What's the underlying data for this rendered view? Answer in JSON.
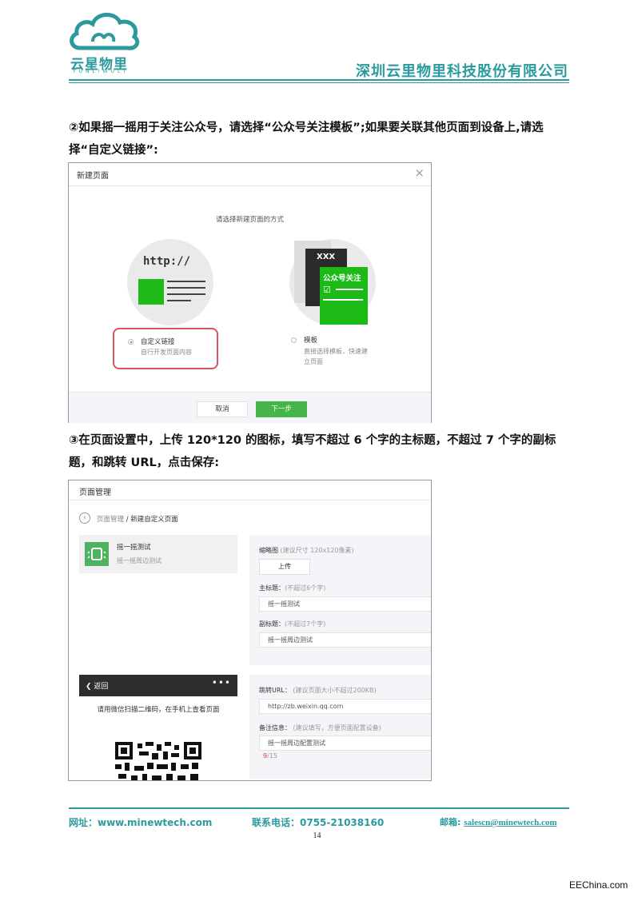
{
  "header": {
    "logo_text": "云星物里",
    "logo_sub": "YUNLIWULI",
    "company": "深圳云里物里科技股份有限公司"
  },
  "colors": {
    "brand": "#2a9a9e",
    "wechat_green": "#44b549",
    "highlight_red": "#d9545f"
  },
  "section2": {
    "text": "②如果摇一摇用于关注公众号，请选择“公众号关注模板”;如果要关联其他页面到设备上,请选择“自定义链接”:",
    "dialog": {
      "title": "新建页面",
      "close": "×",
      "prompt": "请选择新建页面的方式",
      "option_link": {
        "illustration_text": "http://",
        "label": "自定义链接",
        "desc": "自行开发页面内容",
        "selected": true
      },
      "option_template": {
        "illustration_xxx": "XXX",
        "illustration_text": "公众号关注",
        "label": "模板",
        "desc_1": "直接选择模板，快速建",
        "desc_2": "立页面",
        "selected": false
      },
      "cancel": "取消",
      "next": "下一步"
    }
  },
  "section3": {
    "text": "③在页面设置中，上传 120*120 的图标，填写不超过 6 个字的主标题，不超过 7 个字的副标题，和跳转 URL，点击保存:",
    "manager": {
      "title": "页面管理",
      "crumb_root": "页面管理",
      "crumb_sep": " / ",
      "crumb_current": "新建自定义页面",
      "card_title": "摇一摇测试",
      "card_sub": "摇一摇周边测试",
      "thumb_label": "缩略图",
      "thumb_hint": "(建议尺寸 120x120像素)",
      "upload": "上传",
      "main_label": "主标题：",
      "main_hint": "(不超过6个字)",
      "main_value": "摇一摇测试",
      "sub_label": "副标题：",
      "sub_hint": "(不超过7个字)",
      "sub_value": "摇一摇周边测试",
      "url_label": "跳转URL：",
      "url_hint": "(建议页面大小不超过200KB)",
      "url_value": "http://zb.weixin.qq.com",
      "note_label": "备注信息：",
      "note_hint": "(建议填写，方便页面配置设备)",
      "note_value": "摇一摇周边配置测试",
      "count_used": "9",
      "count_max": "/15",
      "phone_back": "返回",
      "phone_menu": "•••",
      "phone_msg": "请用微信扫描二维码，在手机上查看页面"
    }
  },
  "footer": {
    "site": "网址：www.minewtech.com",
    "phone": "联系电话：0755-21038160",
    "email_label": "邮箱:",
    "email": "salescn@minewtech.com",
    "page": "14"
  },
  "watermark": "EEChina.com"
}
